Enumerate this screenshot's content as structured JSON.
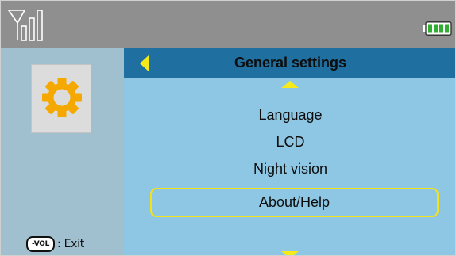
{
  "status_bar": {
    "icons": [
      "signal-icon",
      "battery-icon"
    ],
    "colors": {
      "background": "#8f8f8f",
      "battery_fill": "#2fae2f"
    }
  },
  "sidebar": {
    "icon": "gear-icon",
    "colors": {
      "background": "#a0c0d0",
      "gear": "#f5a800"
    },
    "exit_hint": {
      "key_label": "-VOL",
      "action_label": ": Exit"
    }
  },
  "main": {
    "title": "General settings",
    "back_icon": "chevron-left-icon",
    "menu": {
      "items": [
        {
          "label": "Language",
          "selected": false
        },
        {
          "label": "LCD",
          "selected": false
        },
        {
          "label": "Night vision",
          "selected": false
        },
        {
          "label": "About/Help",
          "selected": true
        }
      ]
    },
    "colors": {
      "background": "#8ec7e4",
      "title_bar": "#1f6fa0",
      "accent": "#f7ea1a",
      "selection_border": "#f3e21a"
    }
  }
}
